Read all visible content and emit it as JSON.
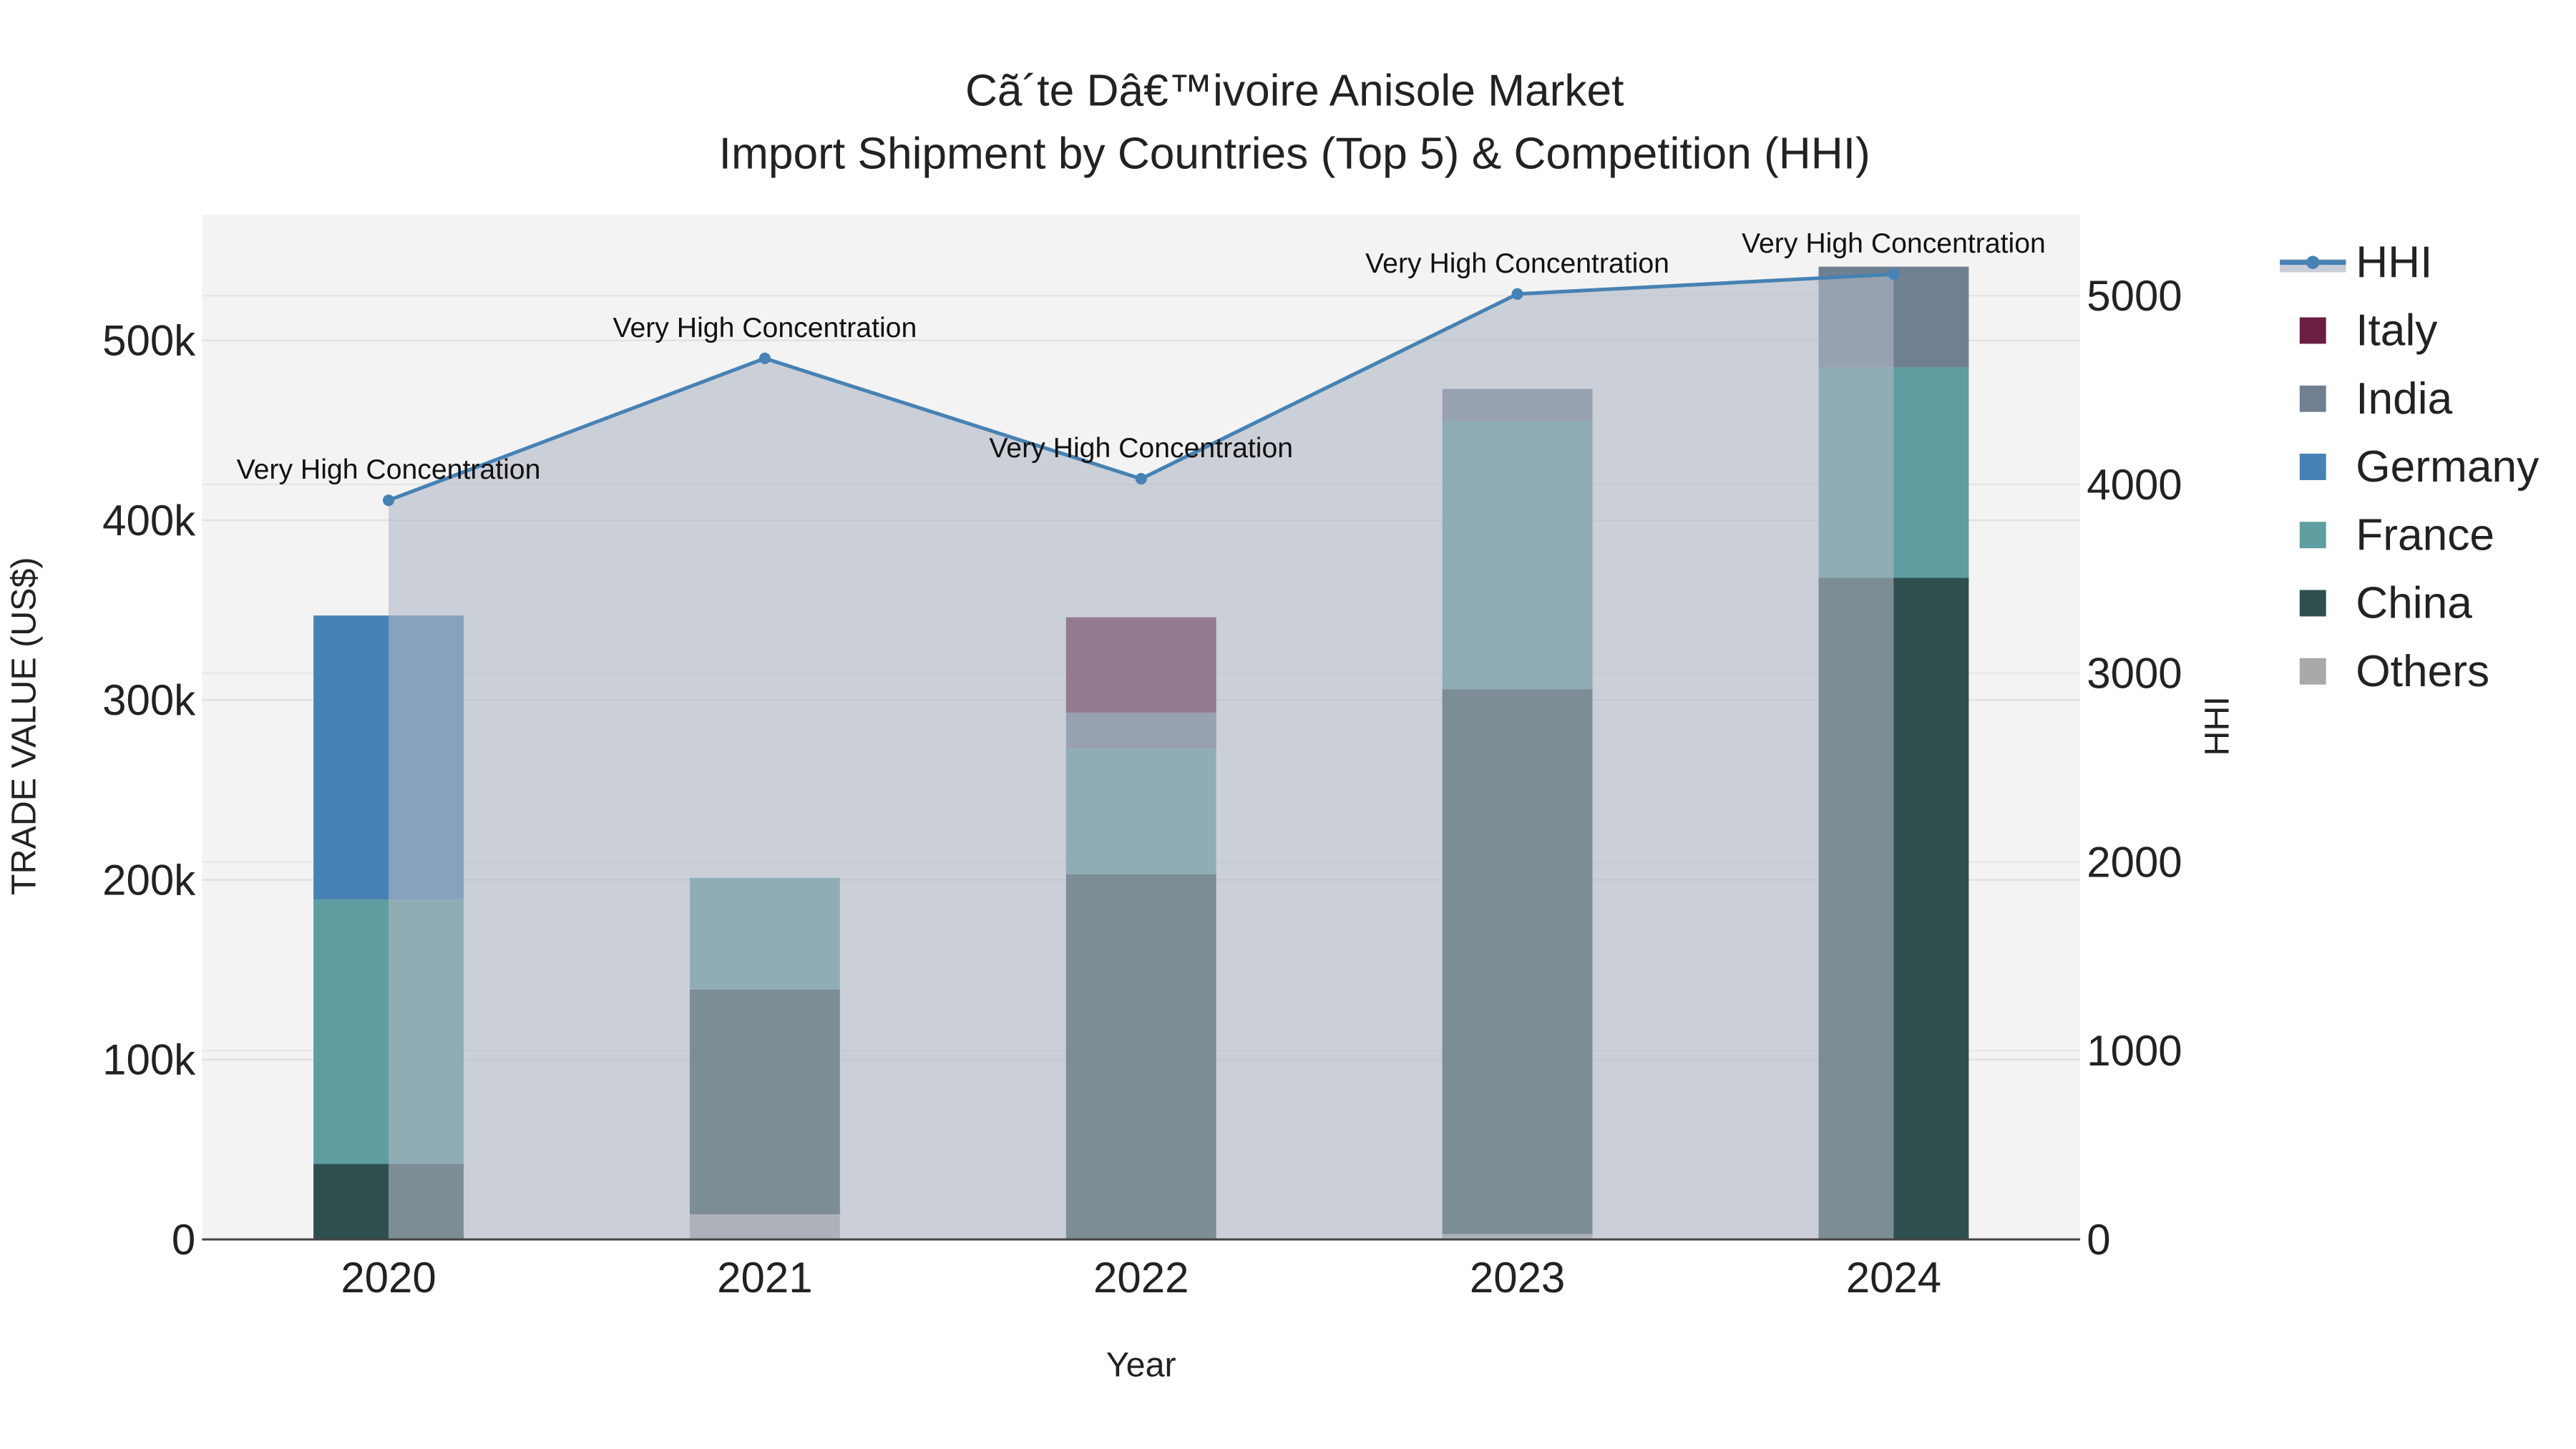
{
  "chart_data": {
    "type": "bar",
    "title": "Cã´te Dâ€™ivoire Anisole Market",
    "subtitle": "Import Shipment by Countries (Top 5) & Competition (HHI)",
    "xlabel": "Year",
    "ylabel": "TRADE VALUE (US$)",
    "y2label": "HHI",
    "categories": [
      "2020",
      "2021",
      "2022",
      "2023",
      "2024"
    ],
    "ylim": [
      0,
      570000
    ],
    "y2lim": [
      0,
      5430
    ],
    "yticks": [
      0,
      100000,
      200000,
      300000,
      400000,
      500000
    ],
    "ytick_labels": [
      "0",
      "100k",
      "200k",
      "300k",
      "400k",
      "500k"
    ],
    "y2ticks": [
      0,
      1000,
      2000,
      3000,
      4000,
      5000
    ],
    "y2tick_labels": [
      "0",
      "1000",
      "2000",
      "3000",
      "4000",
      "5000"
    ],
    "barmode": "stack",
    "series": [
      {
        "name": "Others",
        "color": "#A9A9A9",
        "values": [
          0,
          14000,
          0,
          3000,
          0
        ]
      },
      {
        "name": "China",
        "color": "#2F4F4F",
        "values": [
          42000,
          125000,
          203000,
          303000,
          368000
        ]
      },
      {
        "name": "France",
        "color": "#5F9EA0",
        "values": [
          147000,
          62000,
          70000,
          149000,
          117000
        ]
      },
      {
        "name": "Germany",
        "color": "#4682B4",
        "values": [
          158000,
          0,
          0,
          0,
          0
        ]
      },
      {
        "name": "India",
        "color": "#708090",
        "values": [
          0,
          0,
          20000,
          18000,
          56000
        ]
      },
      {
        "name": "Italy",
        "color": "#6B1E3F",
        "values": [
          0,
          0,
          53000,
          0,
          0
        ]
      }
    ],
    "line": {
      "name": "HHI",
      "color": "#4682B4",
      "values": [
        3916,
        4668,
        4030,
        5009,
        5114
      ],
      "annotations": [
        "Very High Concentration",
        "Very High Concentration",
        "Very High Concentration",
        "Very High Concentration",
        "Very High Concentration"
      ]
    },
    "legend": {
      "placement": "right",
      "entries": [
        "HHI",
        "Italy",
        "India",
        "Germany",
        "France",
        "China",
        "Others"
      ]
    },
    "grid": true
  }
}
